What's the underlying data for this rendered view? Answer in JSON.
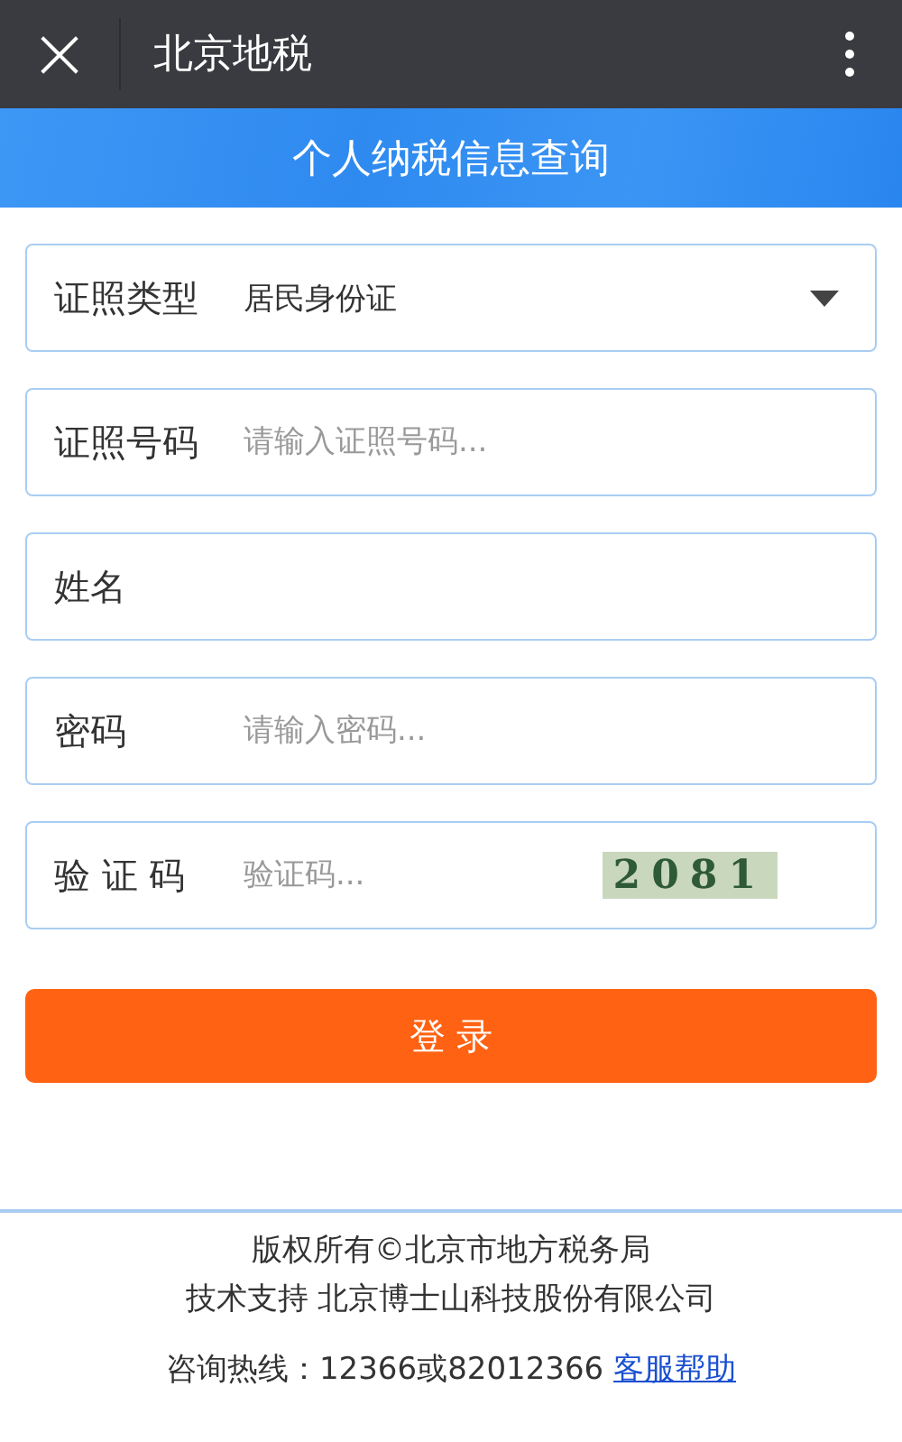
{
  "title_bar": {
    "close_icon": "×",
    "title": "北京地税"
  },
  "banner": {
    "title": "个人纳税信息查询"
  },
  "form": {
    "fields": [
      {
        "kind": "select",
        "label": "证照类型",
        "value": "居民身份证"
      },
      {
        "kind": "input",
        "label": "证照号码",
        "placeholder": "请输入证照号码..."
      },
      {
        "kind": "input",
        "label": "姓名"
      },
      {
        "kind": "input",
        "label": "密码",
        "placeholder": "请输入密码..."
      },
      {
        "kind": "captcha",
        "label": "验 证 码",
        "placeholder": "验证码...",
        "captcha": "2081"
      }
    ],
    "submit": "登 录"
  },
  "footer": {
    "copyright": "版权所有©北京市地方税务局",
    "support": "技术支持 北京博士山科技股份有限公司",
    "hotline": "咨询热线：12366或82012366",
    "help_link": "客服帮助"
  }
}
